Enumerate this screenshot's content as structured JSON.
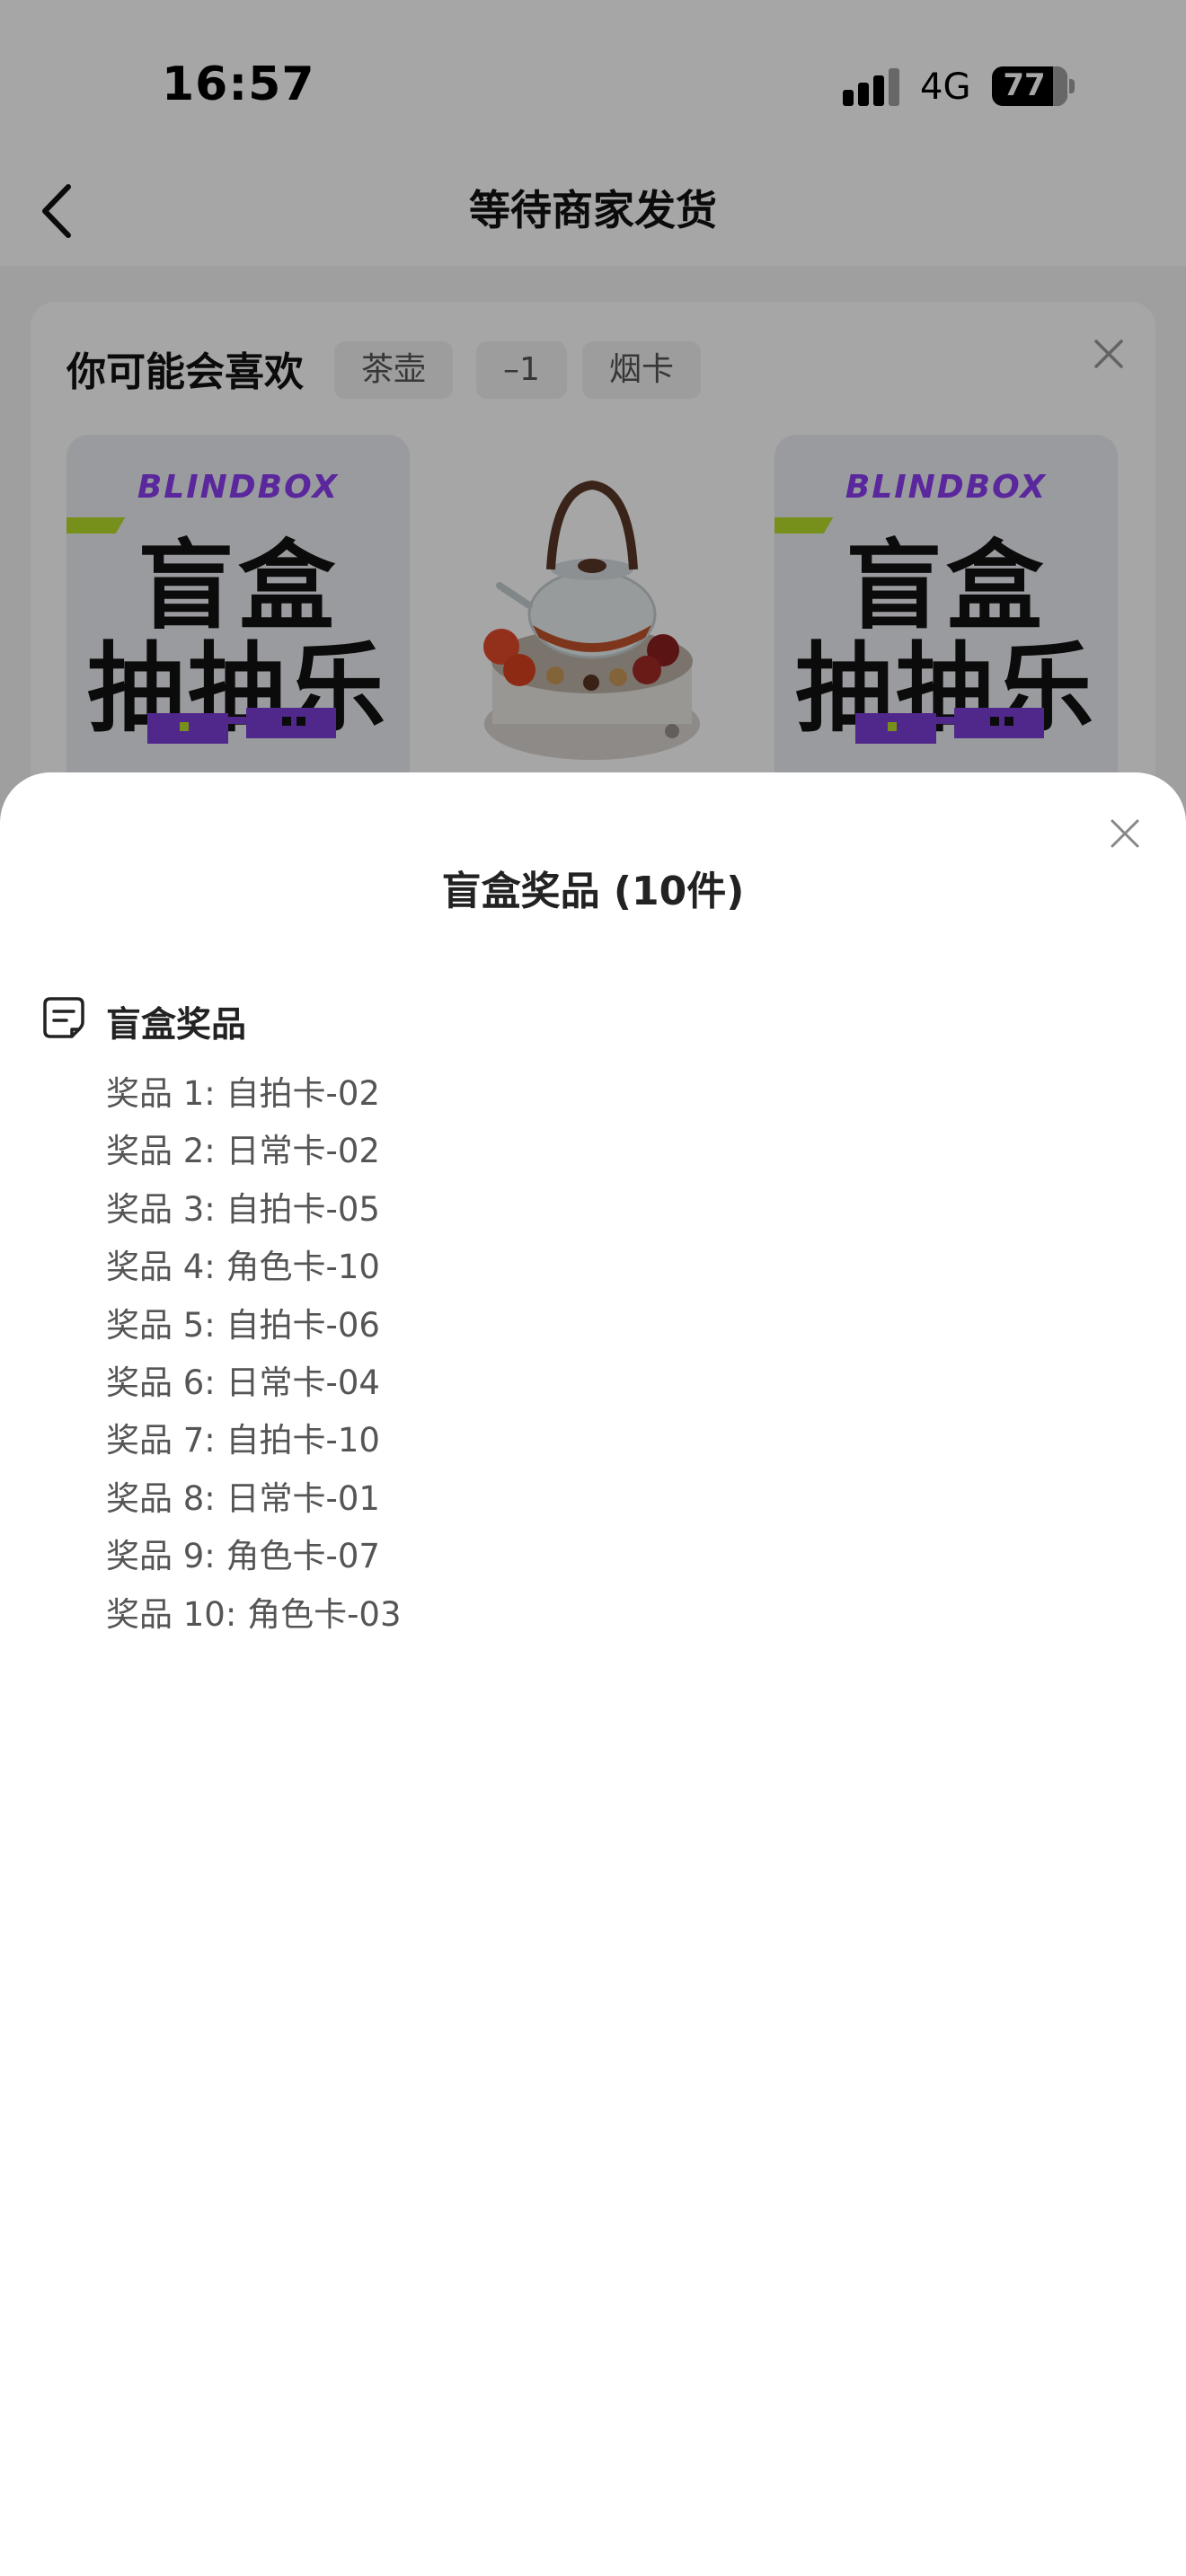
{
  "status_bar": {
    "time": "16:57",
    "network": "4G",
    "battery": "77"
  },
  "nav": {
    "title": "等待商家发货"
  },
  "recommend": {
    "title": "你可能会喜欢",
    "tags": [
      "茶壶",
      "–1",
      "烟卡"
    ],
    "products": [
      {
        "type": "blindbox",
        "brand": "BLINDBOX",
        "line1": "盲盒",
        "line2": "抽抽乐"
      },
      {
        "type": "teapot"
      },
      {
        "type": "blindbox",
        "brand": "BLINDBOX",
        "line1": "盲盒",
        "line2": "抽抽乐"
      }
    ]
  },
  "sheet": {
    "title": "盲盒奖品 (10件)",
    "section_title": "盲盒奖品",
    "prizes": [
      "奖品 1: 自拍卡-02",
      "奖品 2: 日常卡-02",
      "奖品 3: 自拍卡-05",
      "奖品 4: 角色卡-10",
      "奖品 5: 自拍卡-06",
      "奖品 6: 日常卡-04",
      "奖品 7: 自拍卡-10",
      "奖品 8: 日常卡-01",
      "奖品 9: 角色卡-07",
      "奖品 10: 角色卡-03"
    ]
  },
  "colors": {
    "overlay": "rgba(0,0,0,0.35)",
    "brand_purple": "#8a3cf0",
    "accent_green": "#b7dc2a"
  }
}
